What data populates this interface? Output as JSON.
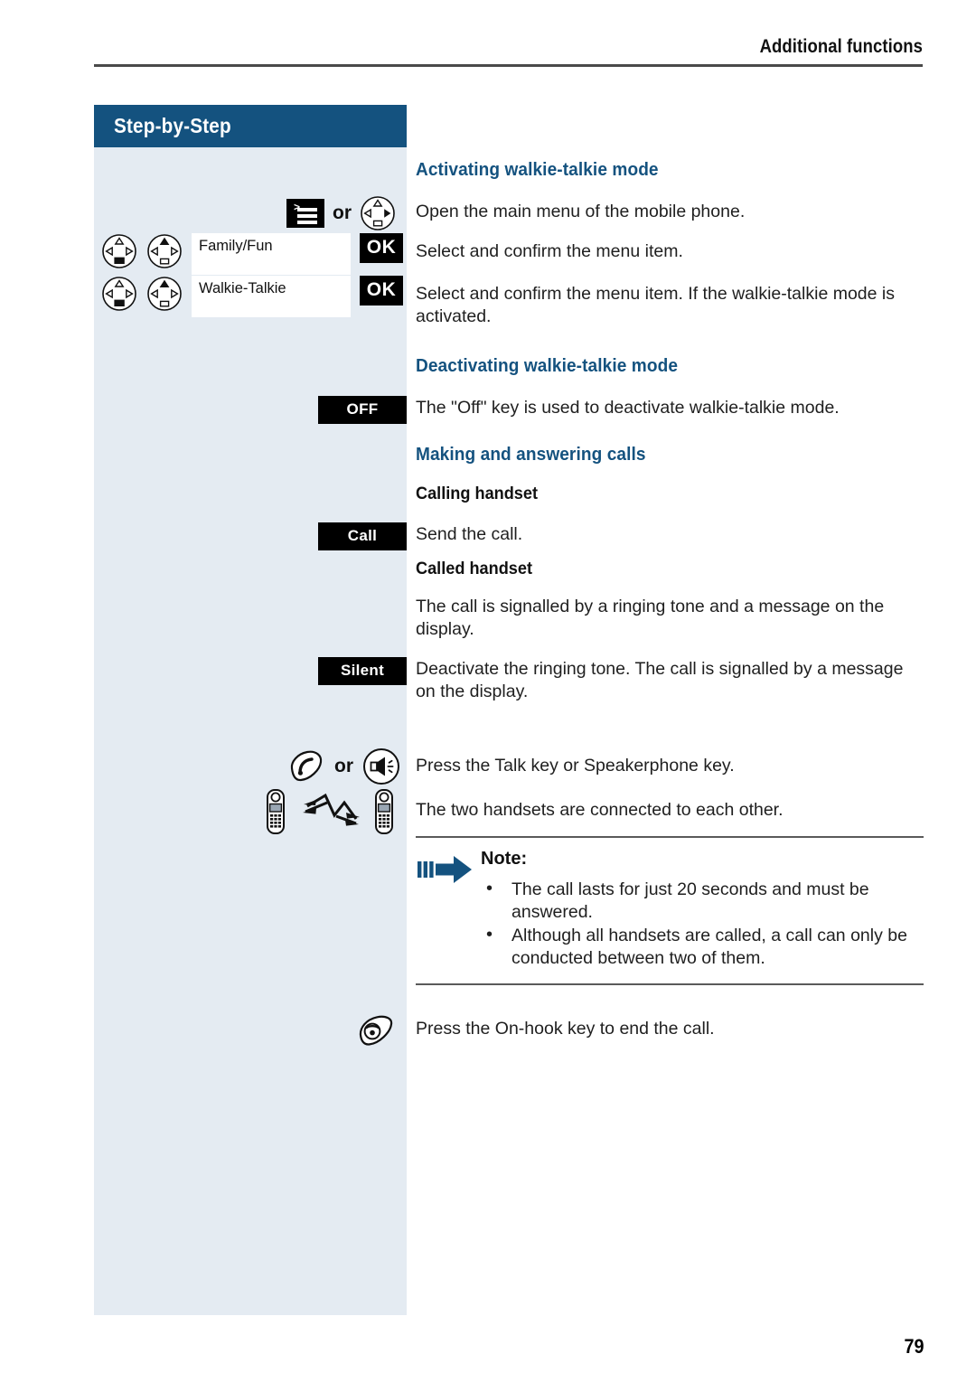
{
  "page": {
    "running_head": "Additional functions",
    "page_number": "79",
    "sidebar_title": "Step-by-Step",
    "accent_color": "#14527f",
    "sidebar_bg": "#e4ebf2"
  },
  "sections": {
    "activating": {
      "heading": "Activating walkie-talkie mode",
      "steps": [
        {
          "icons": [
            "menu-key-icon",
            "or-label",
            "nav-key-right-icon"
          ],
          "or_label": "or",
          "text": "Open the main menu of the mobile phone."
        },
        {
          "icons": [
            "nav-key-down-icon",
            "nav-key-up-icon",
            "display-box",
            "ok-key"
          ],
          "display_text": "Family/Fun",
          "ok_label": "OK",
          "text": "Select and confirm the menu item."
        },
        {
          "icons": [
            "nav-key-down-icon",
            "nav-key-up-icon",
            "display-box",
            "ok-key"
          ],
          "display_text": "Walkie-Talkie",
          "ok_label": "OK",
          "text": "Select and confirm the menu item. If the walkie-talkie mode is activated."
        }
      ]
    },
    "deactivating": {
      "heading": "Deactivating walkie-talkie mode",
      "steps": [
        {
          "key_label": "OFF",
          "text": "The \"Off\" key is used to deactivate walkie-talkie mode."
        }
      ]
    },
    "making_calls": {
      "heading": "Making and answering calls",
      "calling_handset": {
        "subheading": "Calling handset",
        "steps": [
          {
            "key_label": "Call",
            "text": "Send the call."
          }
        ]
      },
      "called_handset": {
        "subheading": "Called handset",
        "steps": [
          {
            "key_label": "",
            "text": "The call is signalled by a ringing tone and a message on the display."
          },
          {
            "key_label": "Silent",
            "text": "Deactivate the ringing tone. The call is signalled by a message on the display."
          }
        ]
      },
      "connect_steps": [
        {
          "icons": [
            "talk-key-icon",
            "or-label",
            "speakerphone-key-icon"
          ],
          "or_label": "or",
          "text": "Press the Talk key or Speakerphone key."
        },
        {
          "icons": [
            "handset-icon",
            "signal-arrows-icon",
            "handset-icon"
          ],
          "text": "The two handsets are connected to each other."
        }
      ],
      "end_call_step": {
        "icons": [
          "on-hook-key-icon"
        ],
        "text": "Press the On-hook key to end the call."
      }
    }
  },
  "note": {
    "title": "Note:",
    "bullets": [
      "The call lasts for just 20 seconds and must be answered.",
      "Although all handsets are called, a call can only be conducted between two of them."
    ]
  }
}
